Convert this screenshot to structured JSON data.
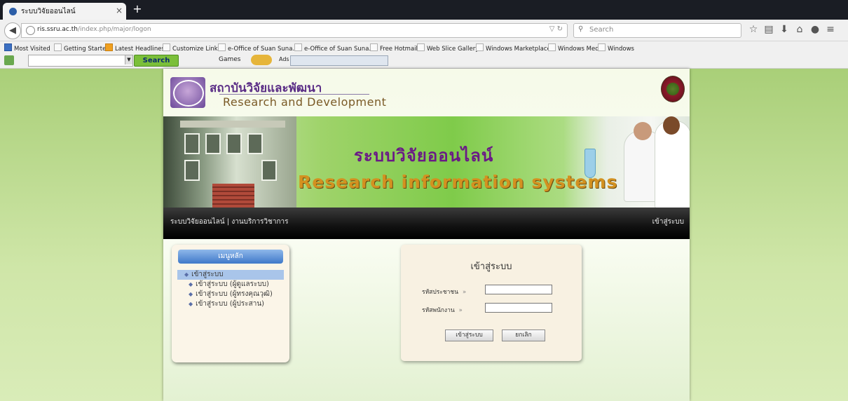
{
  "browser": {
    "tab_title": "ระบบวิจัยออนไลน์",
    "tab_close": "×",
    "new_tab": "+",
    "url_host": "ris.ssru.ac.th",
    "url_path": "/index.php/major/logon",
    "search_placeholder": "Search",
    "bookmarks": [
      "Most Visited",
      "Getting Started",
      "Latest Headlines",
      "Customize Links",
      "e-Office of Suan Suna...",
      "e-Office of Suan Suna...",
      "Free Hotmail",
      "Web Slice Gallery",
      "Windows Marketplace",
      "Windows Media",
      "Windows"
    ],
    "toolbar": {
      "search_label": "Search",
      "games_label": "Games",
      "ads_label": "Ads"
    }
  },
  "site": {
    "brand_th": "สถาบันวิจัยและพัฒนา",
    "brand_en": "Research and Development",
    "banner_th": "ระบบวิจัยออนไลน์",
    "banner_en": "Research information systems",
    "menubar_left": "ระบบวิจัยออนไลน์ | งานบริการวิชาการ",
    "menubar_right": "เข้าสู่ระบบ"
  },
  "sidebar": {
    "title": "เมนูหลัก",
    "items": [
      {
        "label": "เข้าสู่ระบบ",
        "active": true
      },
      {
        "label": "เข้าสู่ระบบ (ผู้ดูแลระบบ)"
      },
      {
        "label": "เข้าสู่ระบบ (ผู้ทรงคุณวุฒิ)"
      },
      {
        "label": "เข้าสู่ระบบ (ผู้ประสาน)"
      }
    ]
  },
  "login": {
    "title": "เข้าสู่ระบบ",
    "id_label": "รหัสประชาชน",
    "emp_label": "รหัสพนักงาน",
    "arrow": "»",
    "id_value": "",
    "emp_value": "",
    "submit_label": "เข้าสู่ระบบ",
    "cancel_label": "ยกเลิก"
  }
}
